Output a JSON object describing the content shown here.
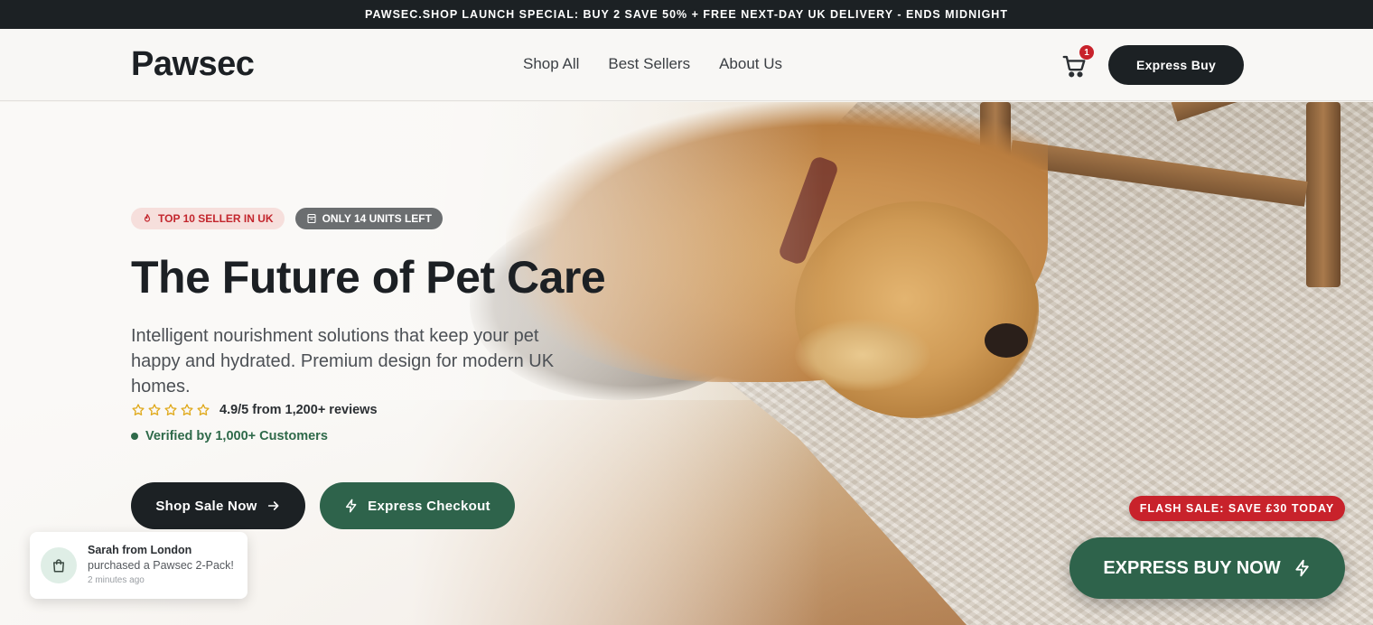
{
  "announcement": {
    "text": "PAWSEC.SHOP LAUNCH SPECIAL: BUY 2 SAVE 50% + FREE NEXT-DAY UK DELIVERY - ENDS MIDNIGHT"
  },
  "header": {
    "logo": "Pawsec",
    "nav": [
      {
        "label": "Shop All"
      },
      {
        "label": "Best Sellers"
      },
      {
        "label": "About Us"
      }
    ],
    "cart_icon": "shopping-cart-icon",
    "cart_count": "1",
    "express_buy_label": "Express Buy"
  },
  "hero": {
    "badges": [
      {
        "label": "TOP 10 SELLER IN UK",
        "icon": "fire-icon"
      },
      {
        "label": "ONLY 14 UNITS LEFT",
        "icon": "box-icon"
      }
    ],
    "title": "The Future of Pet Care",
    "subtitle": "Intelligent nourishment solutions that keep your pet happy and hydrated. Premium design for modern UK homes.",
    "rating_stars": 5,
    "rating_text": "4.9/5 from 1,200+ reviews",
    "verified_text": "Verified by 1,000+ Customers",
    "shop_button": "Shop Sale Now",
    "express_checkout_button": "Express Checkout"
  },
  "flash_sale": {
    "text": "FLASH SALE: SAVE £30 TODAY"
  },
  "express_buy_now": {
    "label": "EXPRESS BUY NOW"
  },
  "toast": {
    "name": "Sarah from London",
    "message": "purchased a Pawsec 2-Pack!",
    "time": "2 minutes ago",
    "icon": "shopping-bag-icon"
  },
  "colors": {
    "dark": "#1c2124",
    "green": "#2e634b",
    "red": "#c8222b"
  }
}
